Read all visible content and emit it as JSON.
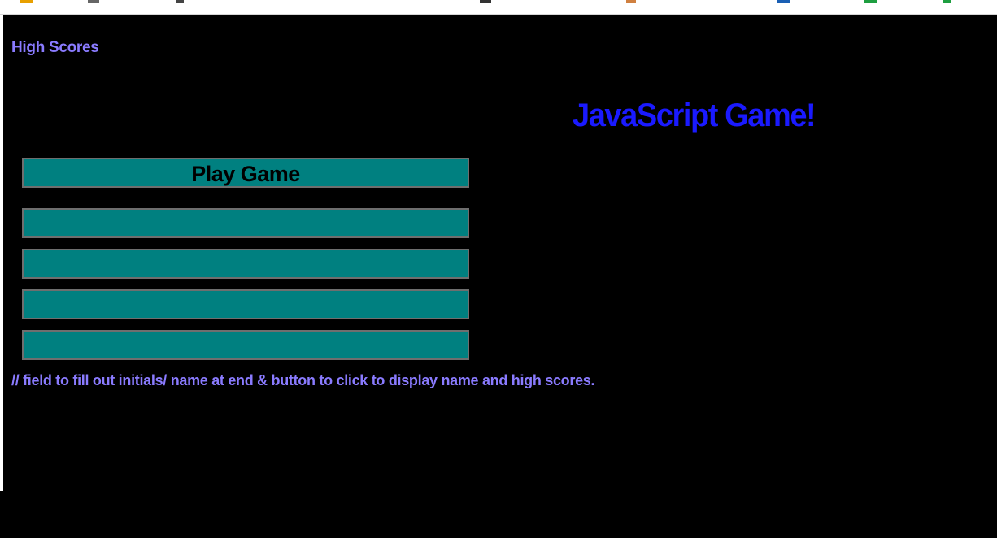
{
  "page": {
    "high_scores_link": "High Scores",
    "title": "JavaScript Game!",
    "comment_note": "// field to fill out initials/ name at end & button to click to display name and high scores."
  },
  "buttons": {
    "play_game": "Play Game",
    "answer_1": "",
    "answer_2": "",
    "answer_3": "",
    "answer_4": ""
  },
  "colors": {
    "background": "#000000",
    "button_fill": "#008080",
    "button_border": "#6e6e6e",
    "link_text": "#8a7bff",
    "title_text": "#1a1aff"
  }
}
